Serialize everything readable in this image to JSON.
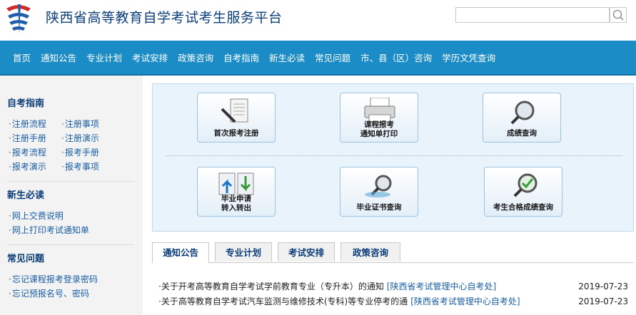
{
  "header": {
    "title": "陕西省高等教育自学考试考生服务平台",
    "search_placeholder": ""
  },
  "nav": [
    "首页",
    "通知公告",
    "专业计划",
    "考试安排",
    "政策咨询",
    "自考指南",
    "新生必读",
    "常见问题",
    "市、县（区）咨询",
    "学历文凭查询"
  ],
  "sidebar": {
    "guide": {
      "title": "自考指南",
      "items": [
        "注册流程",
        "注册事项",
        "注册手册",
        "注册演示",
        "报考流程",
        "报考手册",
        "报考演示",
        "报考事项"
      ]
    },
    "newcomer": {
      "title": "新生必读",
      "items": [
        "网上交费说明",
        "网上打印考试通知单"
      ]
    },
    "faq": {
      "title": "常见问题",
      "items": [
        "忘记课程报考登录密码",
        "忘记预报名号、密码"
      ]
    }
  },
  "services": {
    "first_register": "首次报考注册",
    "course_notice_line1": "课程报考",
    "course_notice_line2": "通知单打印",
    "score_query": "成绩查询",
    "grad_line1": "毕业申请",
    "grad_line2": "转入转出",
    "cert_query": "毕业证书查询",
    "pass_query": "考生合格成绩查询"
  },
  "tabs": [
    "通知公告",
    "专业计划",
    "考试安排",
    "政策咨询"
  ],
  "news": [
    {
      "title": "关于开考高等教育自学考试学前教育专业（专升本）的通知",
      "source": "[陕西省考试管理中心自考处]",
      "date": "2019-07-23"
    },
    {
      "title": "关于高等教育自学考试汽车监测与维修技术(专科)等专业停考的通",
      "source": "[陕西省考试管理中心自考处]",
      "date": "2019-07-23"
    }
  ],
  "colors": {
    "nav_bg": "#1c8cc6",
    "title": "#0b3d78",
    "link": "#1a5fa3"
  }
}
